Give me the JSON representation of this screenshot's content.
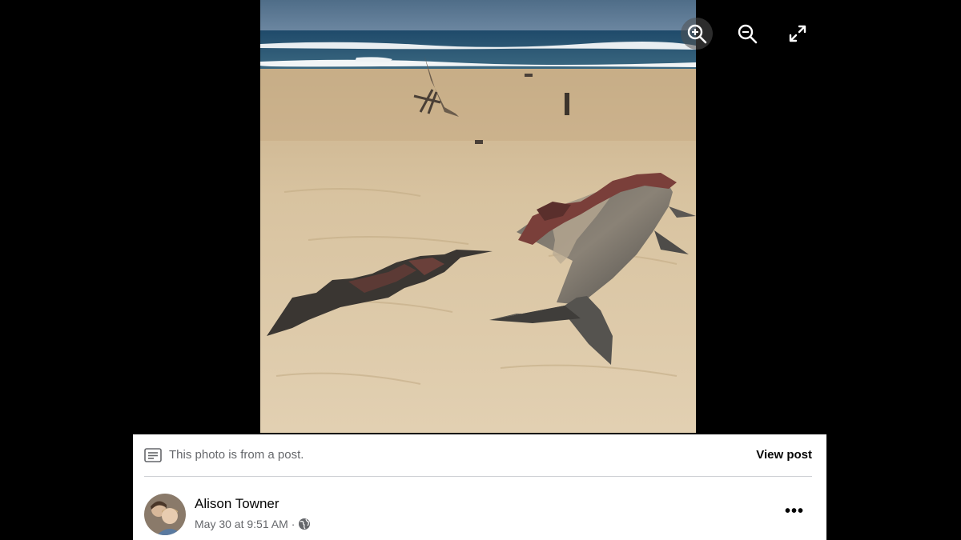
{
  "viewer": {
    "zoom_in_icon": "zoom-in-icon",
    "zoom_out_icon": "zoom-out-icon",
    "fullscreen_icon": "fullscreen-icon"
  },
  "post_banner": {
    "icon": "post-icon",
    "text": "This photo is from a post.",
    "view_post_label": "View post"
  },
  "author": {
    "name": "Alison Towner",
    "date": "May 30 at 9:51 AM",
    "separator": "·",
    "privacy_icon": "globe-icon"
  },
  "more_label": "•••",
  "colors": {
    "background": "#000000",
    "card": "#ffffff",
    "secondary_text": "#65676b",
    "primary_text": "#050505",
    "divider": "#ced0d4"
  }
}
